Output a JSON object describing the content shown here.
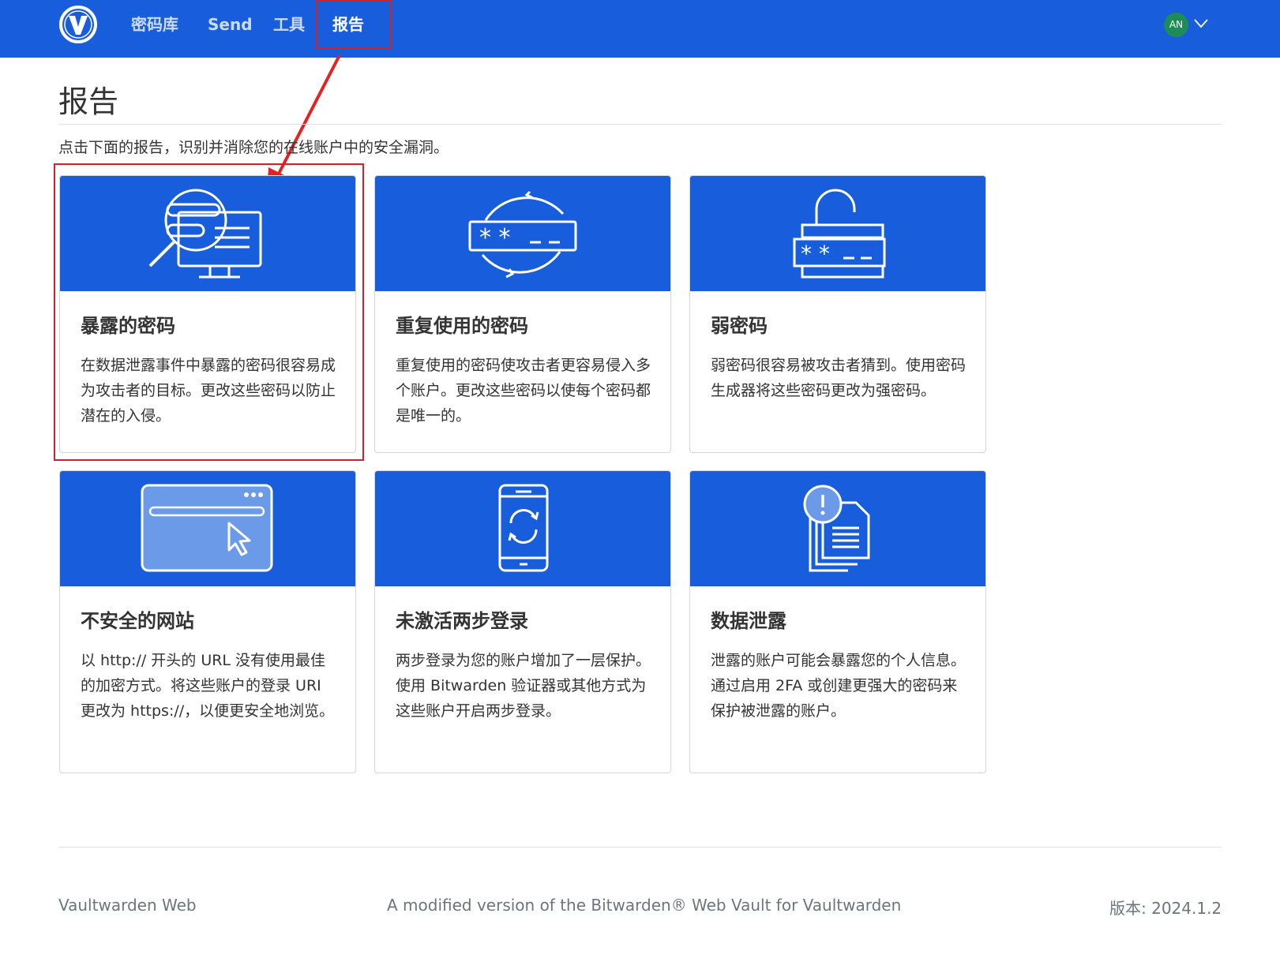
{
  "nav": {
    "items": [
      {
        "label": "密码库",
        "active": false
      },
      {
        "label": "Send",
        "active": false
      },
      {
        "label": "工具",
        "active": false
      },
      {
        "label": "报告",
        "active": true
      }
    ],
    "avatar_initials": "AN"
  },
  "page": {
    "title": "报告",
    "subtitle": "点击下面的报告，识别并消除您的在线账户中的安全漏洞。"
  },
  "reports": [
    {
      "title": "暴露的密码",
      "description": "在数据泄露事件中暴露的密码很容易成为攻击者的目标。更改这些密码以防止潜在的入侵。",
      "icon": "exposed-password-magnifier-icon"
    },
    {
      "title": "重复使用的密码",
      "description": "重复使用的密码使攻击者更容易侵入多个账户。更改这些密码以使每个密码都是唯一的。",
      "icon": "reused-password-icon"
    },
    {
      "title": "弱密码",
      "description": "弱密码很容易被攻击者猜到。使用密码生成器将这些密码更改为强密码。",
      "icon": "weak-password-lock-icon"
    },
    {
      "title": "不安全的网站",
      "description": "以 http:// 开头的 URL 没有使用最佳的加密方式。将这些账户的登录 URI 更改为 https://，以便更安全地浏览。",
      "icon": "insecure-website-browser-icon"
    },
    {
      "title": "未激活两步登录",
      "description": "两步登录为您的账户增加了一层保护。使用 Bitwarden 验证器或其他方式为这些账户开启两步登录。",
      "icon": "two-step-login-phone-icon"
    },
    {
      "title": "数据泄露",
      "description": "泄露的账户可能会暴露您的个人信息。通过启用 2FA 或创建更强大的密码来保护被泄露的账户。",
      "icon": "data-breach-documents-icon"
    }
  ],
  "footer": {
    "left": "Vaultwarden Web",
    "center": "A modified version of the Bitwarden® Web Vault for Vaultwarden",
    "right": "版本: 2024.1.2"
  },
  "colors": {
    "brand": "#175ddc",
    "highlight": "#d0222a",
    "avatar": "#1e8c56"
  }
}
